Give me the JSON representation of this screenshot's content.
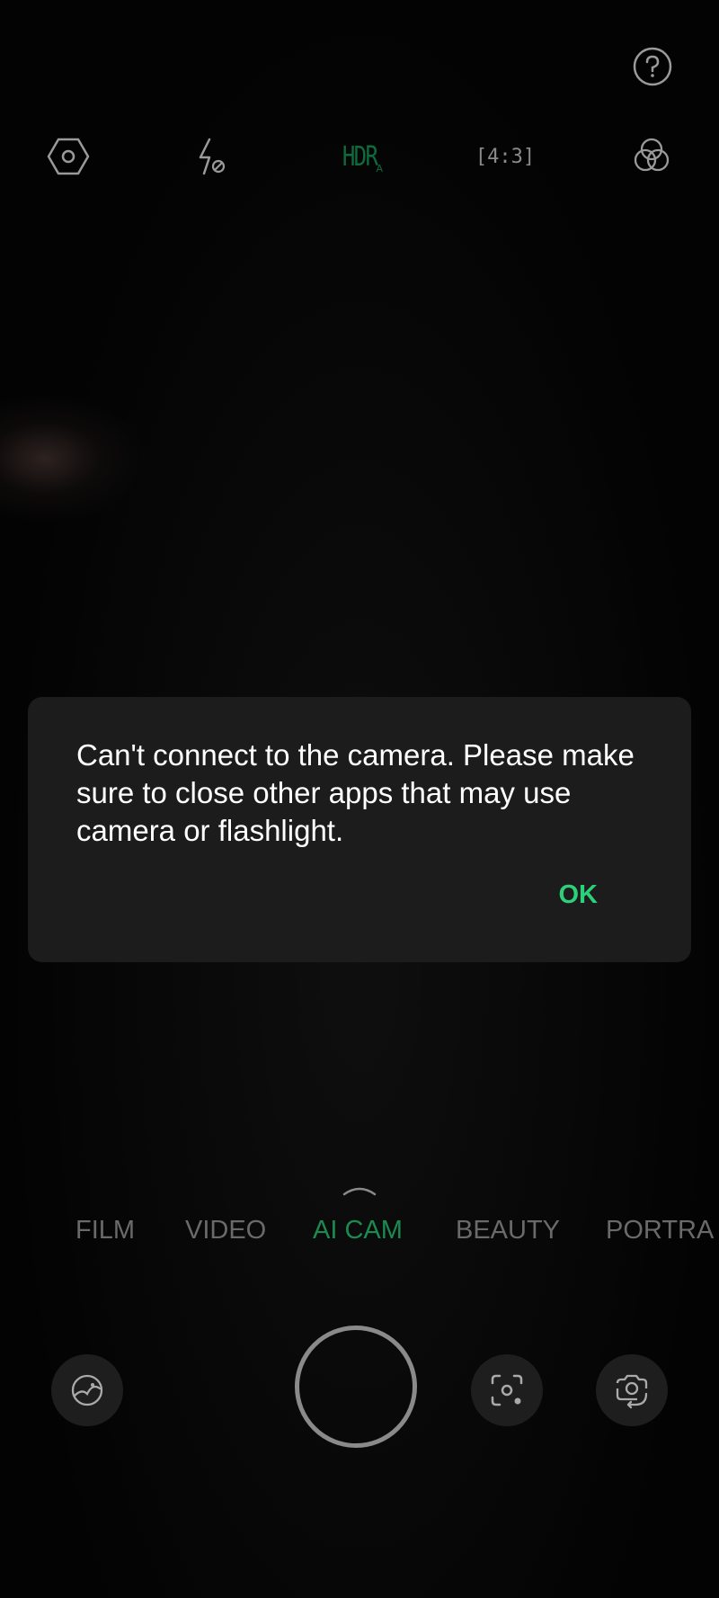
{
  "toolbar": {
    "icons": [
      "settings-hexagon-icon",
      "flash-off-icon",
      "hdr-auto-icon",
      "aspect-ratio-icon",
      "filter-icon"
    ],
    "hdr_label": "HDR",
    "hdr_sub": "A",
    "aspect_ratio_label": "[4:3]",
    "help_icon": "help-icon"
  },
  "dialog": {
    "message": "Can't connect to the camera. Please make sure to close other apps that may use camera or flashlight.",
    "ok_label": "OK"
  },
  "modes": {
    "items": [
      "FILM",
      "VIDEO",
      "AI CAM",
      "BEAUTY",
      "PORTRA"
    ],
    "active": "AI CAM"
  },
  "colors": {
    "accent": "#2dd07a",
    "active_mode": "#1b8a50",
    "hdr": "#0f6b3d",
    "dialog_bg": "#1c1c1c",
    "inactive_text": "#6a6a6a"
  },
  "bottom_controls": {
    "icons": [
      "gallery-icon",
      "shutter-button",
      "google-lens-icon",
      "switch-camera-icon"
    ]
  }
}
